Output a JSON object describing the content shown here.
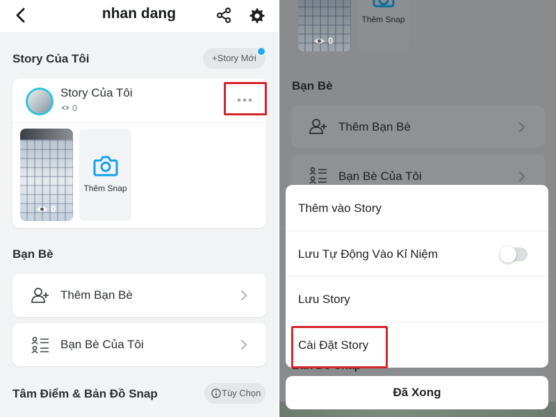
{
  "left": {
    "header": {
      "title": "nhan dang",
      "back_icon": "chevron-left-icon",
      "share_icon": "share-icon",
      "settings_icon": "gear-icon"
    },
    "my_story": {
      "section_title": "Story Của Tôi",
      "new_story_button": "+Story Mới",
      "story_name": "Story Của Tôi",
      "story_views": "0",
      "more_icon": "more-horizontal-icon",
      "snap_views": "0",
      "add_snap_label": "Thêm Snap",
      "camera_icon": "camera-icon"
    },
    "friends": {
      "section_title": "Bạn Bè",
      "items": [
        {
          "label": "Thêm Bạn Bè",
          "icon": "add-friend-icon"
        },
        {
          "label": "Bạn Bè Của Tôi",
          "icon": "friends-list-icon"
        }
      ]
    },
    "spotlight": {
      "section_title": "Tâm Điểm & Bản Đồ Snap",
      "options_button": "Tùy Chọn",
      "info_icon": "info-icon"
    }
  },
  "right": {
    "background": {
      "add_snap_label": "Thêm Snap",
      "snap_views": "0",
      "friends_title": "Bạn Bè",
      "friends_items": [
        "Thêm Bạn Bè",
        "Bạn Bè Của Tôi"
      ],
      "map_title": "Bản Đồ Snap"
    },
    "sheet": {
      "options": [
        "Thêm vào Story",
        "Lưu Tự Động Vào Kỉ Niệm",
        "Lưu Story",
        "Cài Đặt Story"
      ],
      "auto_save_enabled": false,
      "done_button": "Đã Xong"
    }
  },
  "colors": {
    "accent_blue": "#22a8f0",
    "highlight_red": "#d4232a",
    "overlay_gray": "#8a8b8d"
  }
}
